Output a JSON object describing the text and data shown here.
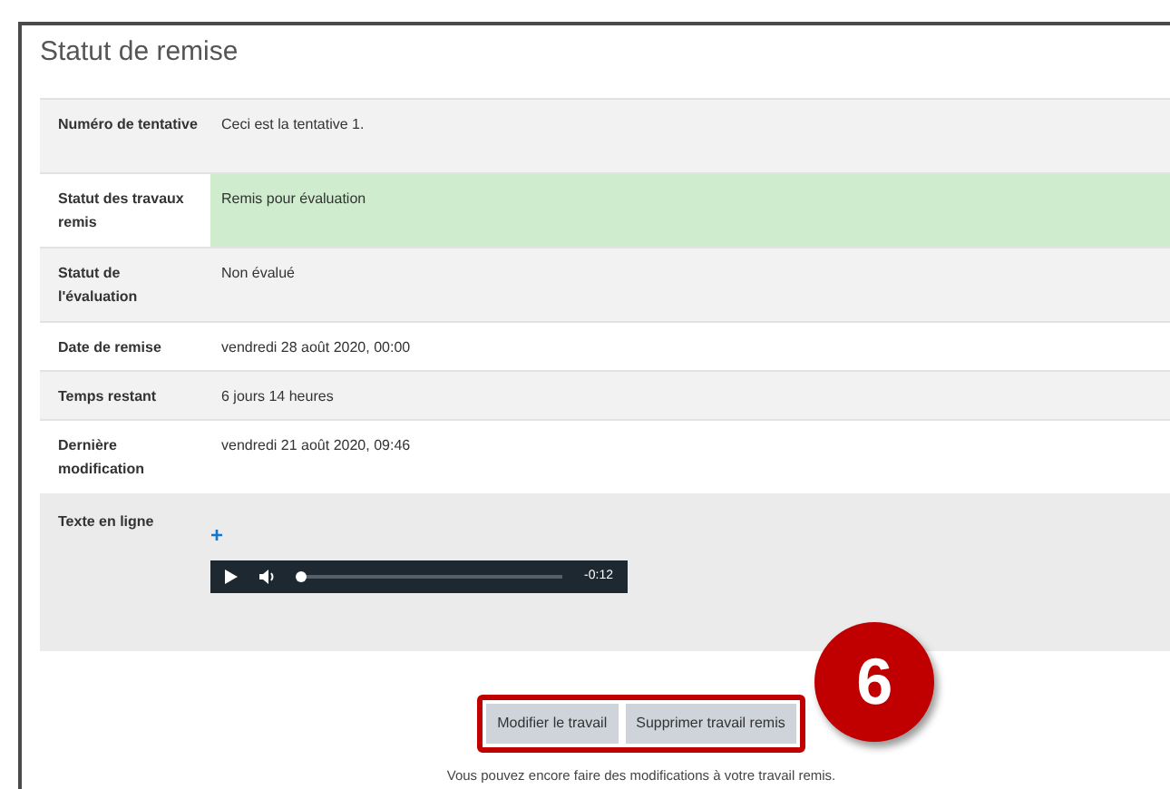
{
  "section_title": "Statut de remise",
  "rows": [
    {
      "kind": "text",
      "label": "Numéro de tentative",
      "value": "Ceci est la tentative 1.",
      "highlighted": false
    },
    {
      "kind": "text",
      "label": "Statut des travaux remis",
      "value": "Remis pour évaluation",
      "highlighted": true
    },
    {
      "kind": "text",
      "label": "Statut de l'évaluation",
      "value": "Non évalué",
      "highlighted": false
    },
    {
      "kind": "text",
      "label": "Date de remise",
      "value": "vendredi 28 août 2020, 00:00",
      "highlighted": false
    },
    {
      "kind": "text",
      "label": "Temps restant",
      "value": "6 jours 14 heures",
      "highlighted": false
    },
    {
      "kind": "text",
      "label": "Dernière modification",
      "value": "vendredi 21 août 2020, 09:46",
      "highlighted": false
    },
    {
      "kind": "audio",
      "label": "Texte en ligne",
      "expand": "+",
      "player": {
        "time": "-0:12",
        "level": 0.0
      }
    }
  ],
  "buttons": [
    "Modifier le travail",
    "Supprimer travail remis"
  ],
  "callout": "6",
  "note": "Vous pouvez encore faire des modifications à votre travail remis."
}
